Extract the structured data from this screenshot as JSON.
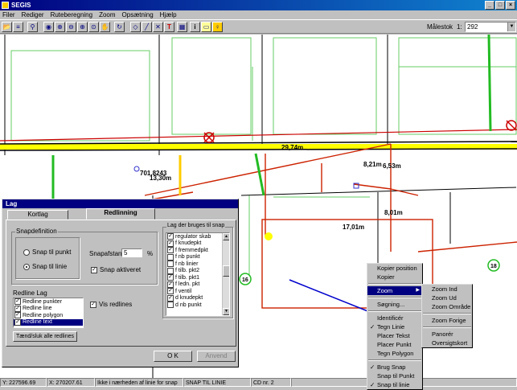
{
  "app": {
    "title": "SEGIS",
    "menu": [
      "Filer",
      "Rediger",
      "Ruteberegning",
      "Zoom",
      "Opsætning",
      "Hjælp"
    ],
    "window_buttons": [
      "_",
      "□",
      "×"
    ]
  },
  "toolbar": {
    "icons": [
      "open-icon",
      "layers-icon",
      "binoculars-icon",
      "globe-icon",
      "zoom-in-icon",
      "zoom-out-icon",
      "zoom-area-icon",
      "zoom-fit-icon",
      "pan-hand-icon",
      "rotate-icon",
      "polygon-icon",
      "line-icon",
      "delete-icon",
      "text-icon",
      "grid-icon",
      "info-icon",
      "rectangle-icon",
      "lamp-icon"
    ],
    "icon_glyphs": [
      "📂",
      "≡",
      "⚲",
      "◉",
      "⊕",
      "⊖",
      "⊕",
      "⊙",
      "✋",
      "↻",
      "◇",
      "╱",
      "✕",
      "T",
      "▦",
      "i",
      "▭",
      "♀"
    ],
    "scale_label": "Målestok",
    "scale_prefix": "1:",
    "scale_value": "292"
  },
  "map_labels": {
    "dim1": "29,74m",
    "dim2": "701,8243",
    "dim3": "13,30m",
    "dim4": "8,21m",
    "dim5": "6,53m",
    "dim6": "17,01m",
    "dim7": "8,01m",
    "house1": "16",
    "house2": "18"
  },
  "dialog": {
    "title": "Lag",
    "tabs": [
      "Kortlag",
      "Redlinning"
    ],
    "active_tab": "Redlinning",
    "snap_group": "Snapdefinition",
    "snap_options": [
      "Snap til punkt",
      "Snap til linie"
    ],
    "snap_selected": 1,
    "snap_distance_label": "Snapafstand:",
    "snap_distance_value": "5",
    "snap_distance_unit": "%",
    "snap_active_label": "Snap aktiveret",
    "snap_active": true,
    "snap_layers_group": "Lag der bruges til snap",
    "snap_layers": [
      {
        "label": "regulator skab",
        "checked": true
      },
      {
        "label": "f knudepkt",
        "checked": true
      },
      {
        "label": "f fremmedpkt",
        "checked": true
      },
      {
        "label": "f nb punkt",
        "checked": false
      },
      {
        "label": "f nb linier",
        "checked": false
      },
      {
        "label": "f tilb. pkt2",
        "checked": false
      },
      {
        "label": "f tilb. pkt1",
        "checked": true
      },
      {
        "label": "f ledn. pkt",
        "checked": true
      },
      {
        "label": "f ventil",
        "checked": true
      },
      {
        "label": "d knudepkt",
        "checked": true
      },
      {
        "label": "d nb punkt",
        "checked": false
      }
    ],
    "redline_group": "Redline Lag",
    "redline_layers": [
      {
        "label": "Redline punkter",
        "checked": true,
        "selected": false
      },
      {
        "label": "Redline line",
        "checked": true,
        "selected": false
      },
      {
        "label": "Redline polygon",
        "checked": true,
        "selected": false
      },
      {
        "label": "Redline text",
        "checked": true,
        "selected": true
      }
    ],
    "show_redlines_label": "Vis redlines",
    "show_redlines": true,
    "toggle_all_button": "Tænd/sluk alle redlines",
    "ok_button": "O K",
    "apply_button": "Anvend"
  },
  "context_menu": {
    "items": [
      {
        "label": "Kopier position",
        "check": false
      },
      {
        "label": "Kopier",
        "check": false
      },
      {
        "sep": true
      },
      {
        "label": "Zoom",
        "check": false,
        "submenu": true,
        "selected": true
      },
      {
        "sep": true
      },
      {
        "label": "Søgning...",
        "check": false
      },
      {
        "sep": true
      },
      {
        "label": "Identificér",
        "check": false
      },
      {
        "label": "Tegn Linie",
        "check": true
      },
      {
        "label": "Placer Tekst",
        "check": false
      },
      {
        "label": "Placer Punkt",
        "check": false
      },
      {
        "label": "Tegn Polygon",
        "check": false
      },
      {
        "sep": true
      },
      {
        "label": "Brug Snap",
        "check": true
      },
      {
        "label": "Snap til Punkt",
        "check": false
      },
      {
        "label": "Snap til linie",
        "check": true
      }
    ]
  },
  "zoom_submenu": {
    "items": [
      {
        "label": "Zoom Ind"
      },
      {
        "label": "Zoom Ud"
      },
      {
        "label": "Zoom Område"
      },
      {
        "sep": true
      },
      {
        "label": "Zoom Forige"
      },
      {
        "sep": true
      },
      {
        "label": "Panorér"
      },
      {
        "label": "Oversigtskort"
      }
    ]
  },
  "status": {
    "y": "Y: 227596.69",
    "x": "X: 270207.61",
    "message": "Ikke i nærheden af linie for snap",
    "mode": "SNAP TIL LINIE",
    "cd": "CD nr. 2"
  },
  "colors": {
    "title_bar": "#000080",
    "road_yellow": "#ffff00",
    "pipe_green": "#22bb22",
    "redline": "#cc2200",
    "building_red": "#cc0000"
  }
}
